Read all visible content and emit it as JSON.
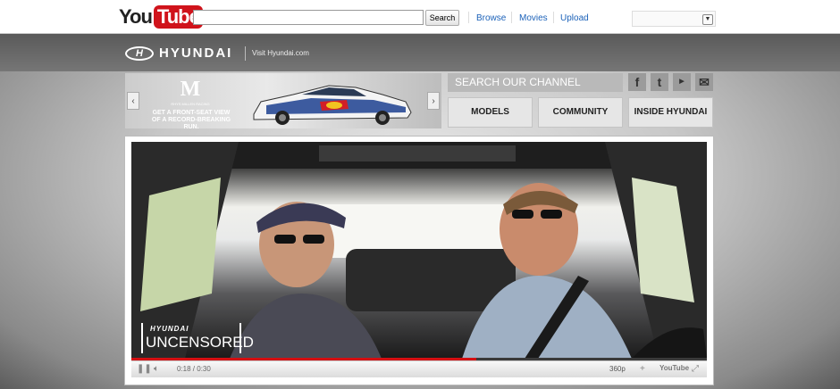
{
  "youtube_bar": {
    "logo_you": "You",
    "logo_tube": "Tube",
    "search_button": "Search",
    "search_placeholder": "",
    "nav": [
      "Browse",
      "Movies",
      "Upload"
    ]
  },
  "hyundai": {
    "brand": "HYUNDAI",
    "visit_link": "Visit Hyundai.com"
  },
  "banner": {
    "crest_letter": "M",
    "crest_caption": "RHYS MILLEN RACING",
    "promo_text": "GET A FRONT-SEAT VIEW OF A RECORD-BREAKING RUN.",
    "prev_arrow": "‹",
    "next_arrow": "›"
  },
  "channel": {
    "search_label": "SEARCH OUR CHANNEL",
    "social_icons": [
      "facebook-icon",
      "twitter-icon",
      "youtube-icon",
      "email-icon"
    ],
    "buttons": [
      "MODELS",
      "COMMUNITY",
      "INSIDE HYUNDAI"
    ]
  },
  "player": {
    "overlay_brand": "HYUNDAI",
    "overlay_title": "UNCENSORED",
    "current_time": "0:18",
    "duration": "0:30",
    "progress_fraction": 0.6,
    "quality": "360p",
    "youtube_mini": "YouTube",
    "time_display": "0:18 / 0:30"
  },
  "colors": {
    "youtube_red": "#d0131b",
    "link_blue": "#1c62b9",
    "progress_red": "#d40f12"
  }
}
